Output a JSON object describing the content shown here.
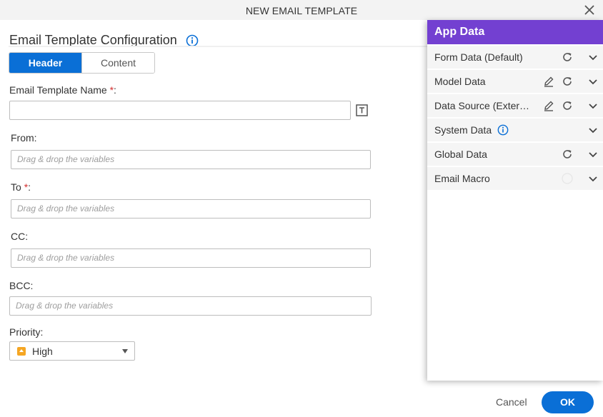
{
  "dialog": {
    "title": "NEW EMAIL TEMPLATE"
  },
  "config": {
    "title": "Email Template Configuration"
  },
  "tabs": [
    {
      "label": "Header",
      "active": true
    },
    {
      "label": "Content",
      "active": false
    }
  ],
  "fields": {
    "template_name": {
      "label": "Email Template Name",
      "required_mark": "*",
      "suffix": ":",
      "value": ""
    },
    "from": {
      "label": "From:",
      "placeholder": "Drag & drop the variables"
    },
    "to": {
      "label": "To",
      "required_mark": "*",
      "suffix": ":",
      "placeholder": "Drag & drop the variables"
    },
    "cc": {
      "label": "CC:",
      "placeholder": "Drag & drop the variables"
    },
    "bcc": {
      "label": "BCC:",
      "placeholder": "Drag & drop the variables"
    },
    "priority": {
      "label": "Priority:",
      "value": "High"
    }
  },
  "app_data": {
    "title": "App Data",
    "items": [
      {
        "label": "Form Data (Default)",
        "icons": [
          "refresh-icon",
          "chevron-down-icon"
        ]
      },
      {
        "label": "Model Data",
        "icons": [
          "edit-icon",
          "refresh-icon",
          "chevron-down-icon"
        ]
      },
      {
        "label": "Data Source (Exter…",
        "icons": [
          "edit-icon",
          "refresh-icon",
          "chevron-down-icon"
        ]
      },
      {
        "label": "System Data",
        "icons": [
          "info-icon",
          "chevron-down-icon"
        ]
      },
      {
        "label": "Global Data",
        "icons": [
          "refresh-icon",
          "chevron-down-icon"
        ]
      },
      {
        "label": "Email Macro",
        "icons": [
          "help-icon",
          "chevron-down-icon"
        ]
      }
    ]
  },
  "footer": {
    "cancel_label": "Cancel",
    "ok_label": "OK"
  },
  "colors": {
    "primary": "#0a6fd6",
    "panel_header": "#7340d1",
    "required": "#d32f2f",
    "priority_high": "#f5a623"
  }
}
